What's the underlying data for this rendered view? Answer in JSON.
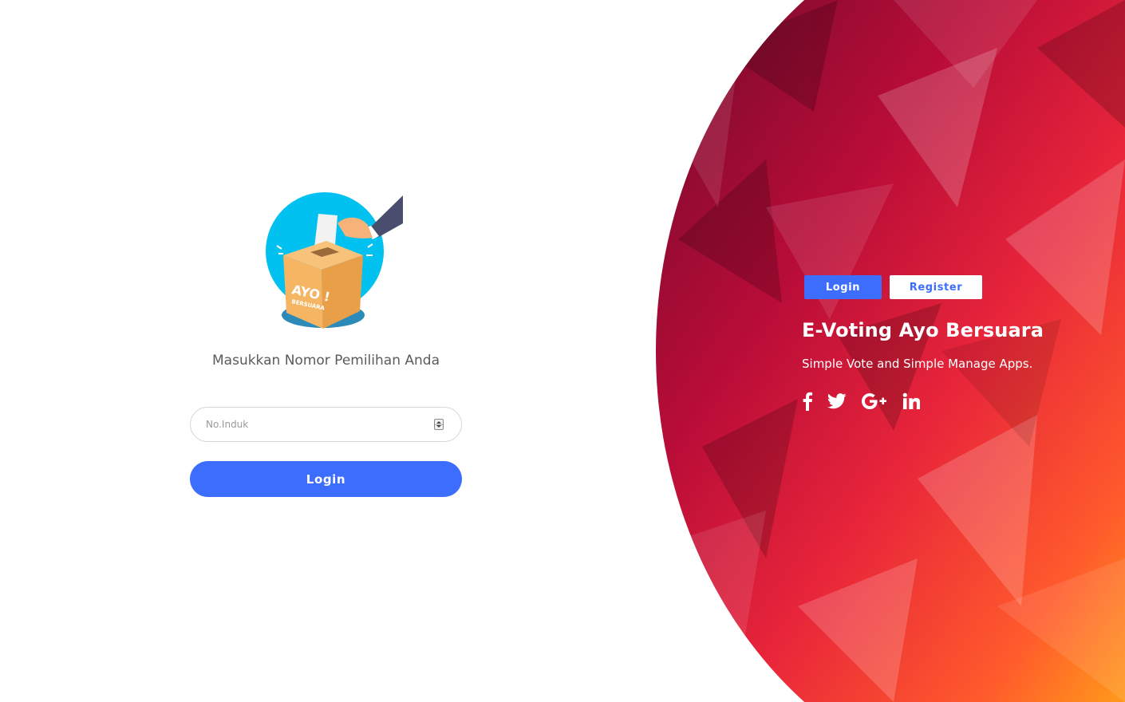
{
  "colors": {
    "accent": "#3d6dfc",
    "hero_dark": "#7a0a2a",
    "hero_mid": "#d3123f",
    "hero_light": "#ff8a1e"
  },
  "login_form": {
    "logo_text_main": "AYO !",
    "logo_text_sub": "BERSUARA",
    "prompt": "Masukkan Nomor Pemilihan Anda",
    "input_placeholder": "No.Induk",
    "input_value": "",
    "submit_label": "Login"
  },
  "hero": {
    "tabs": [
      {
        "label": "Login",
        "active": true
      },
      {
        "label": "Register",
        "active": false
      }
    ],
    "title": "E-Voting Ayo Bersuara",
    "subtitle": "Simple Vote and Simple Manage Apps.",
    "social_icons": [
      "facebook-icon",
      "twitter-icon",
      "google-plus-icon",
      "linkedin-icon"
    ]
  }
}
